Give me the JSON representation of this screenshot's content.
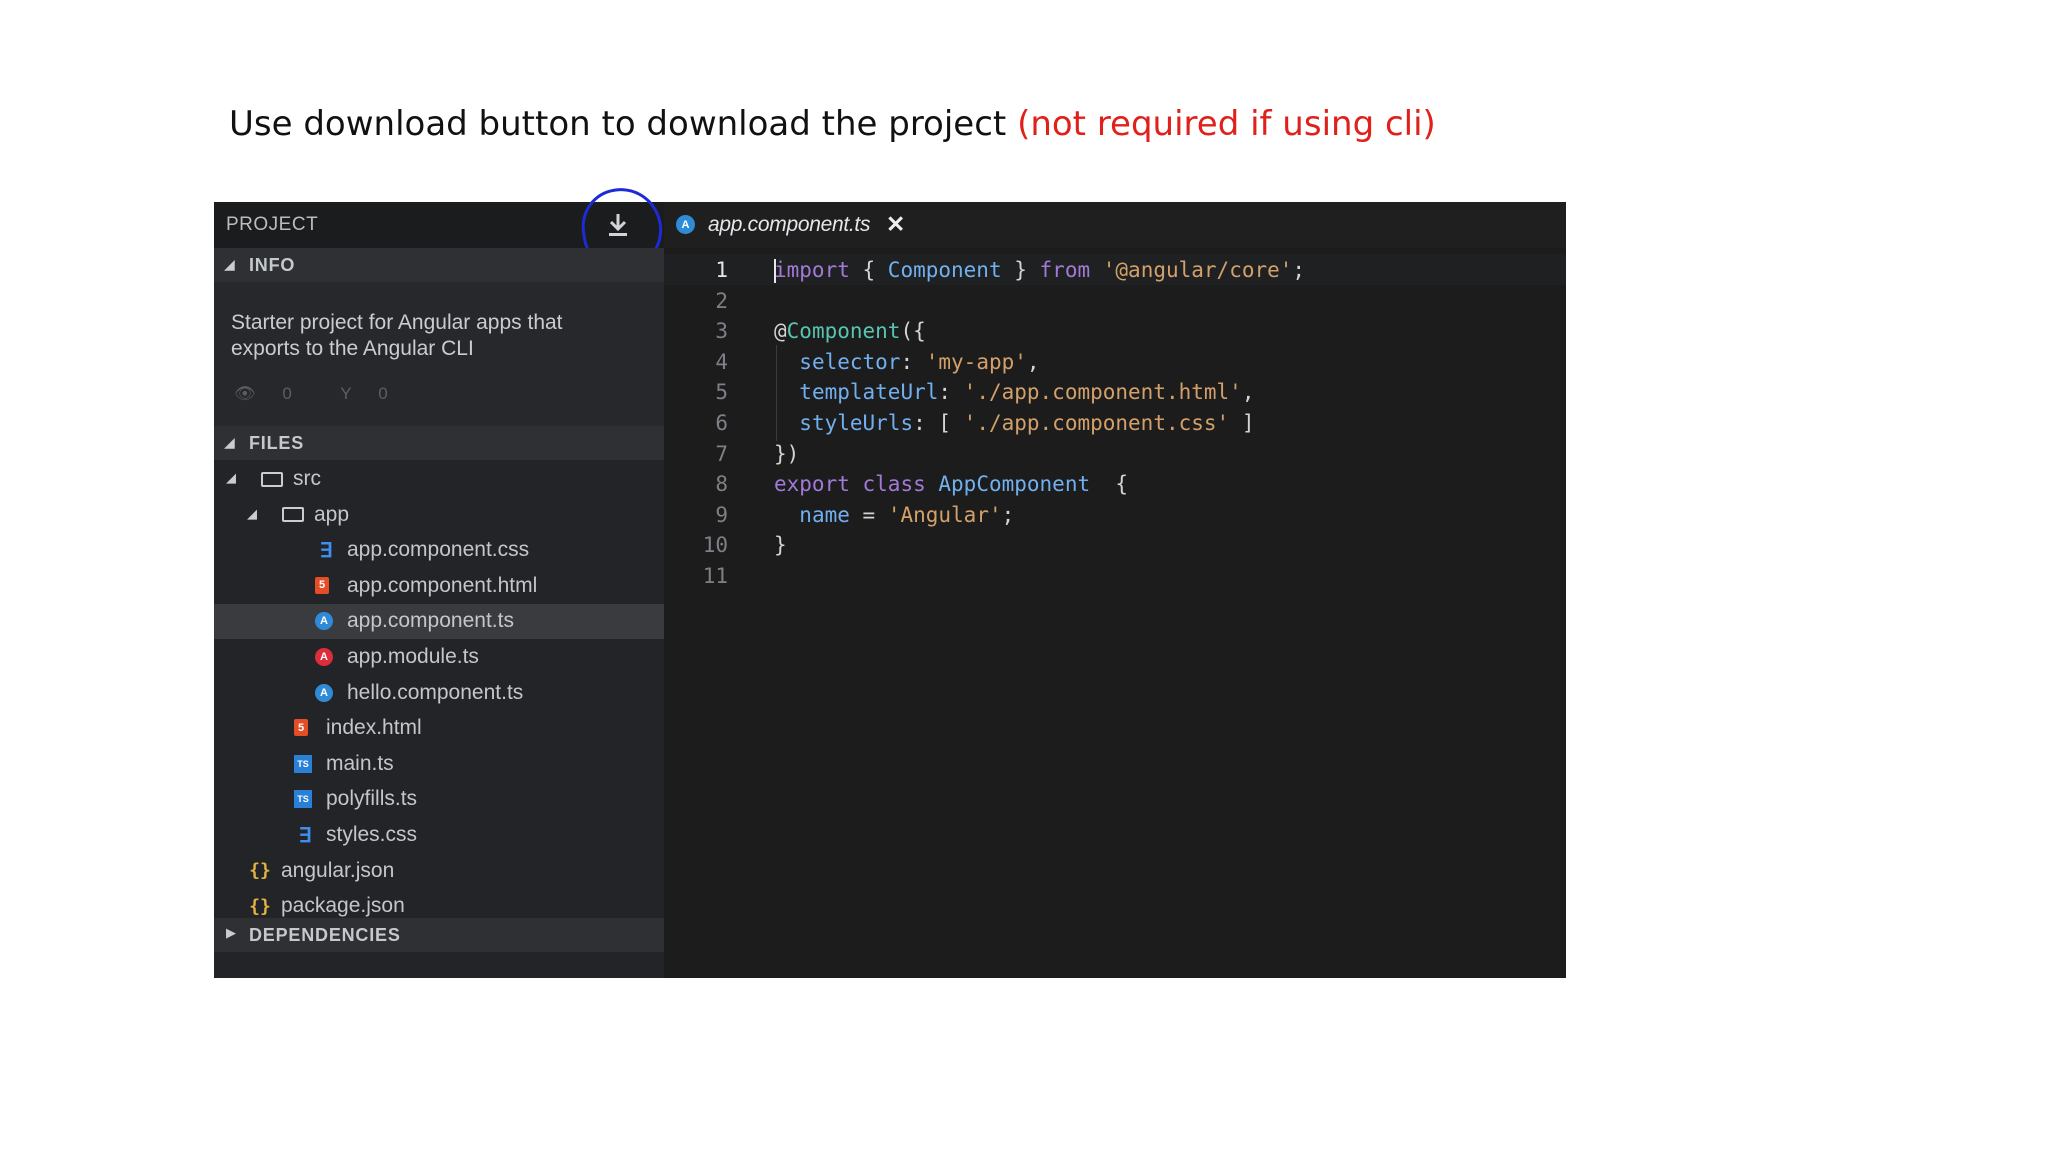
{
  "heading": {
    "text": "Use download button to download the project ",
    "note": "(not required if using cli)"
  },
  "sidebar": {
    "title": "PROJECT",
    "download_icon": "download-icon",
    "info": {
      "label": "INFO",
      "description": "Starter project for Angular apps that exports to the Angular CLI",
      "views": "0",
      "forks": "0"
    },
    "files_label": "FILES",
    "dependencies_label": "DEPENDENCIES",
    "tree": [
      {
        "name": "src",
        "icon": "folder-icon",
        "depth": 0,
        "expanded": true
      },
      {
        "name": "app",
        "icon": "folder-icon",
        "depth": 1,
        "expanded": true
      },
      {
        "name": "app.component.css",
        "icon": "css-icon",
        "depth": 2
      },
      {
        "name": "app.component.html",
        "icon": "html-icon",
        "depth": 2
      },
      {
        "name": "app.component.ts",
        "icon": "angular-icon",
        "depth": 2,
        "selected": true
      },
      {
        "name": "app.module.ts",
        "icon": "angular-module-icon",
        "depth": 2
      },
      {
        "name": "hello.component.ts",
        "icon": "angular-icon",
        "depth": 2
      },
      {
        "name": "index.html",
        "icon": "html-icon",
        "depth": 1
      },
      {
        "name": "main.ts",
        "icon": "typescript-icon",
        "depth": 1
      },
      {
        "name": "polyfills.ts",
        "icon": "typescript-icon",
        "depth": 1
      },
      {
        "name": "styles.css",
        "icon": "css-icon",
        "depth": 1
      },
      {
        "name": "angular.json",
        "icon": "json-icon",
        "depth": 0
      },
      {
        "name": "package.json",
        "icon": "json-icon",
        "depth": 0
      }
    ]
  },
  "editor": {
    "tab": {
      "name": "app.component.ts",
      "icon": "angular-icon",
      "close": "✕"
    },
    "lines": [
      {
        "n": "1",
        "tokens": [
          [
            "kw",
            "import"
          ],
          [
            "pl",
            " { "
          ],
          [
            "id",
            "Component"
          ],
          [
            "pl",
            " } "
          ],
          [
            "kw",
            "from"
          ],
          [
            "pl",
            " "
          ],
          [
            "str",
            "'@angular/core'"
          ],
          [
            "pl",
            ";"
          ]
        ]
      },
      {
        "n": "2",
        "tokens": []
      },
      {
        "n": "3",
        "tokens": [
          [
            "pl",
            "@"
          ],
          [
            "fn",
            "Component"
          ],
          [
            "pl",
            "({"
          ]
        ]
      },
      {
        "n": "4",
        "tokens": [
          [
            "pl",
            "  "
          ],
          [
            "id",
            "selector"
          ],
          [
            "pl",
            ": "
          ],
          [
            "str",
            "'my-app'"
          ],
          [
            "pl",
            ","
          ]
        ]
      },
      {
        "n": "5",
        "tokens": [
          [
            "pl",
            "  "
          ],
          [
            "id",
            "templateUrl"
          ],
          [
            "pl",
            ": "
          ],
          [
            "str",
            "'./app.component.html'"
          ],
          [
            "pl",
            ","
          ]
        ]
      },
      {
        "n": "6",
        "tokens": [
          [
            "pl",
            "  "
          ],
          [
            "id",
            "styleUrls"
          ],
          [
            "pl",
            ": [ "
          ],
          [
            "str",
            "'./app.component.css'"
          ],
          [
            "pl",
            " ]"
          ]
        ]
      },
      {
        "n": "7",
        "tokens": [
          [
            "pl",
            "})"
          ]
        ]
      },
      {
        "n": "8",
        "tokens": [
          [
            "kw",
            "export"
          ],
          [
            "pl",
            " "
          ],
          [
            "kw",
            "class"
          ],
          [
            "pl",
            " "
          ],
          [
            "id",
            "AppComponent"
          ],
          [
            "pl",
            "  {"
          ]
        ]
      },
      {
        "n": "9",
        "tokens": [
          [
            "pl",
            "  "
          ],
          [
            "id",
            "name"
          ],
          [
            "pl",
            " = "
          ],
          [
            "str",
            "'Angular'"
          ],
          [
            "pl",
            ";"
          ]
        ]
      },
      {
        "n": "10",
        "tokens": [
          [
            "pl",
            "}"
          ]
        ]
      },
      {
        "n": "11",
        "tokens": []
      }
    ]
  },
  "colors": {
    "keyword": "#a27ad6",
    "identifier": "#71b0ef",
    "string": "#d3a06a",
    "annotation_ring": "#1d2ad6",
    "note_red": "#e0201b"
  }
}
